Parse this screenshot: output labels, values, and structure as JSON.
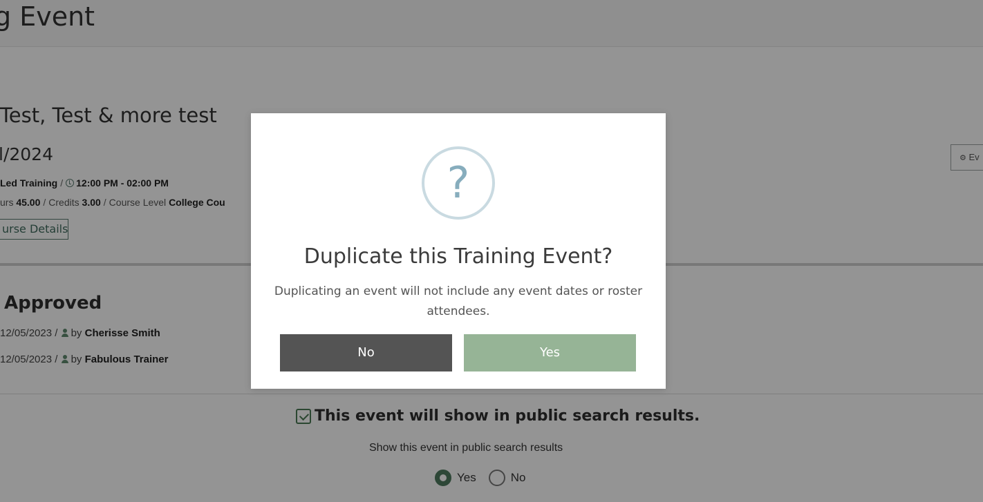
{
  "page": {
    "title": "g Event"
  },
  "event": {
    "title": "Test, Test & more test",
    "date": "l/2024",
    "meta1": {
      "type": "Led Training",
      "time": "12:00 PM - 02:00 PM"
    },
    "meta2": {
      "hours_label": "urs",
      "hours_value": "45.00",
      "credits_label": "Credits",
      "credits_value": "3.00",
      "level_label": "Course Level",
      "level_value": "College Cou"
    },
    "course_details_button": "urse Details",
    "events_button": "Ev"
  },
  "status": {
    "title": "Approved",
    "line1_date": "12/05/2023",
    "line1_by": "by",
    "line1_user": "Cherisse Smith",
    "line2_date": "12/05/2023",
    "line2_by": "by",
    "line2_user": "Fabulous Trainer"
  },
  "public_search": {
    "heading": "This event will show in public search results.",
    "subtext": "Show this event in public search results",
    "options": [
      "Yes",
      "No"
    ],
    "selected": "Yes"
  },
  "modal": {
    "icon": "question-mark-icon",
    "icon_glyph": "?",
    "title": "Duplicate this Training Event?",
    "text": "Duplicating an event will not include any event dates or roster attendees.",
    "no_label": "No",
    "yes_label": "Yes"
  },
  "colors": {
    "accent_green": "#96b496",
    "dark_button": "#545454",
    "overlay": "rgba(0,0,0,0.42)"
  }
}
